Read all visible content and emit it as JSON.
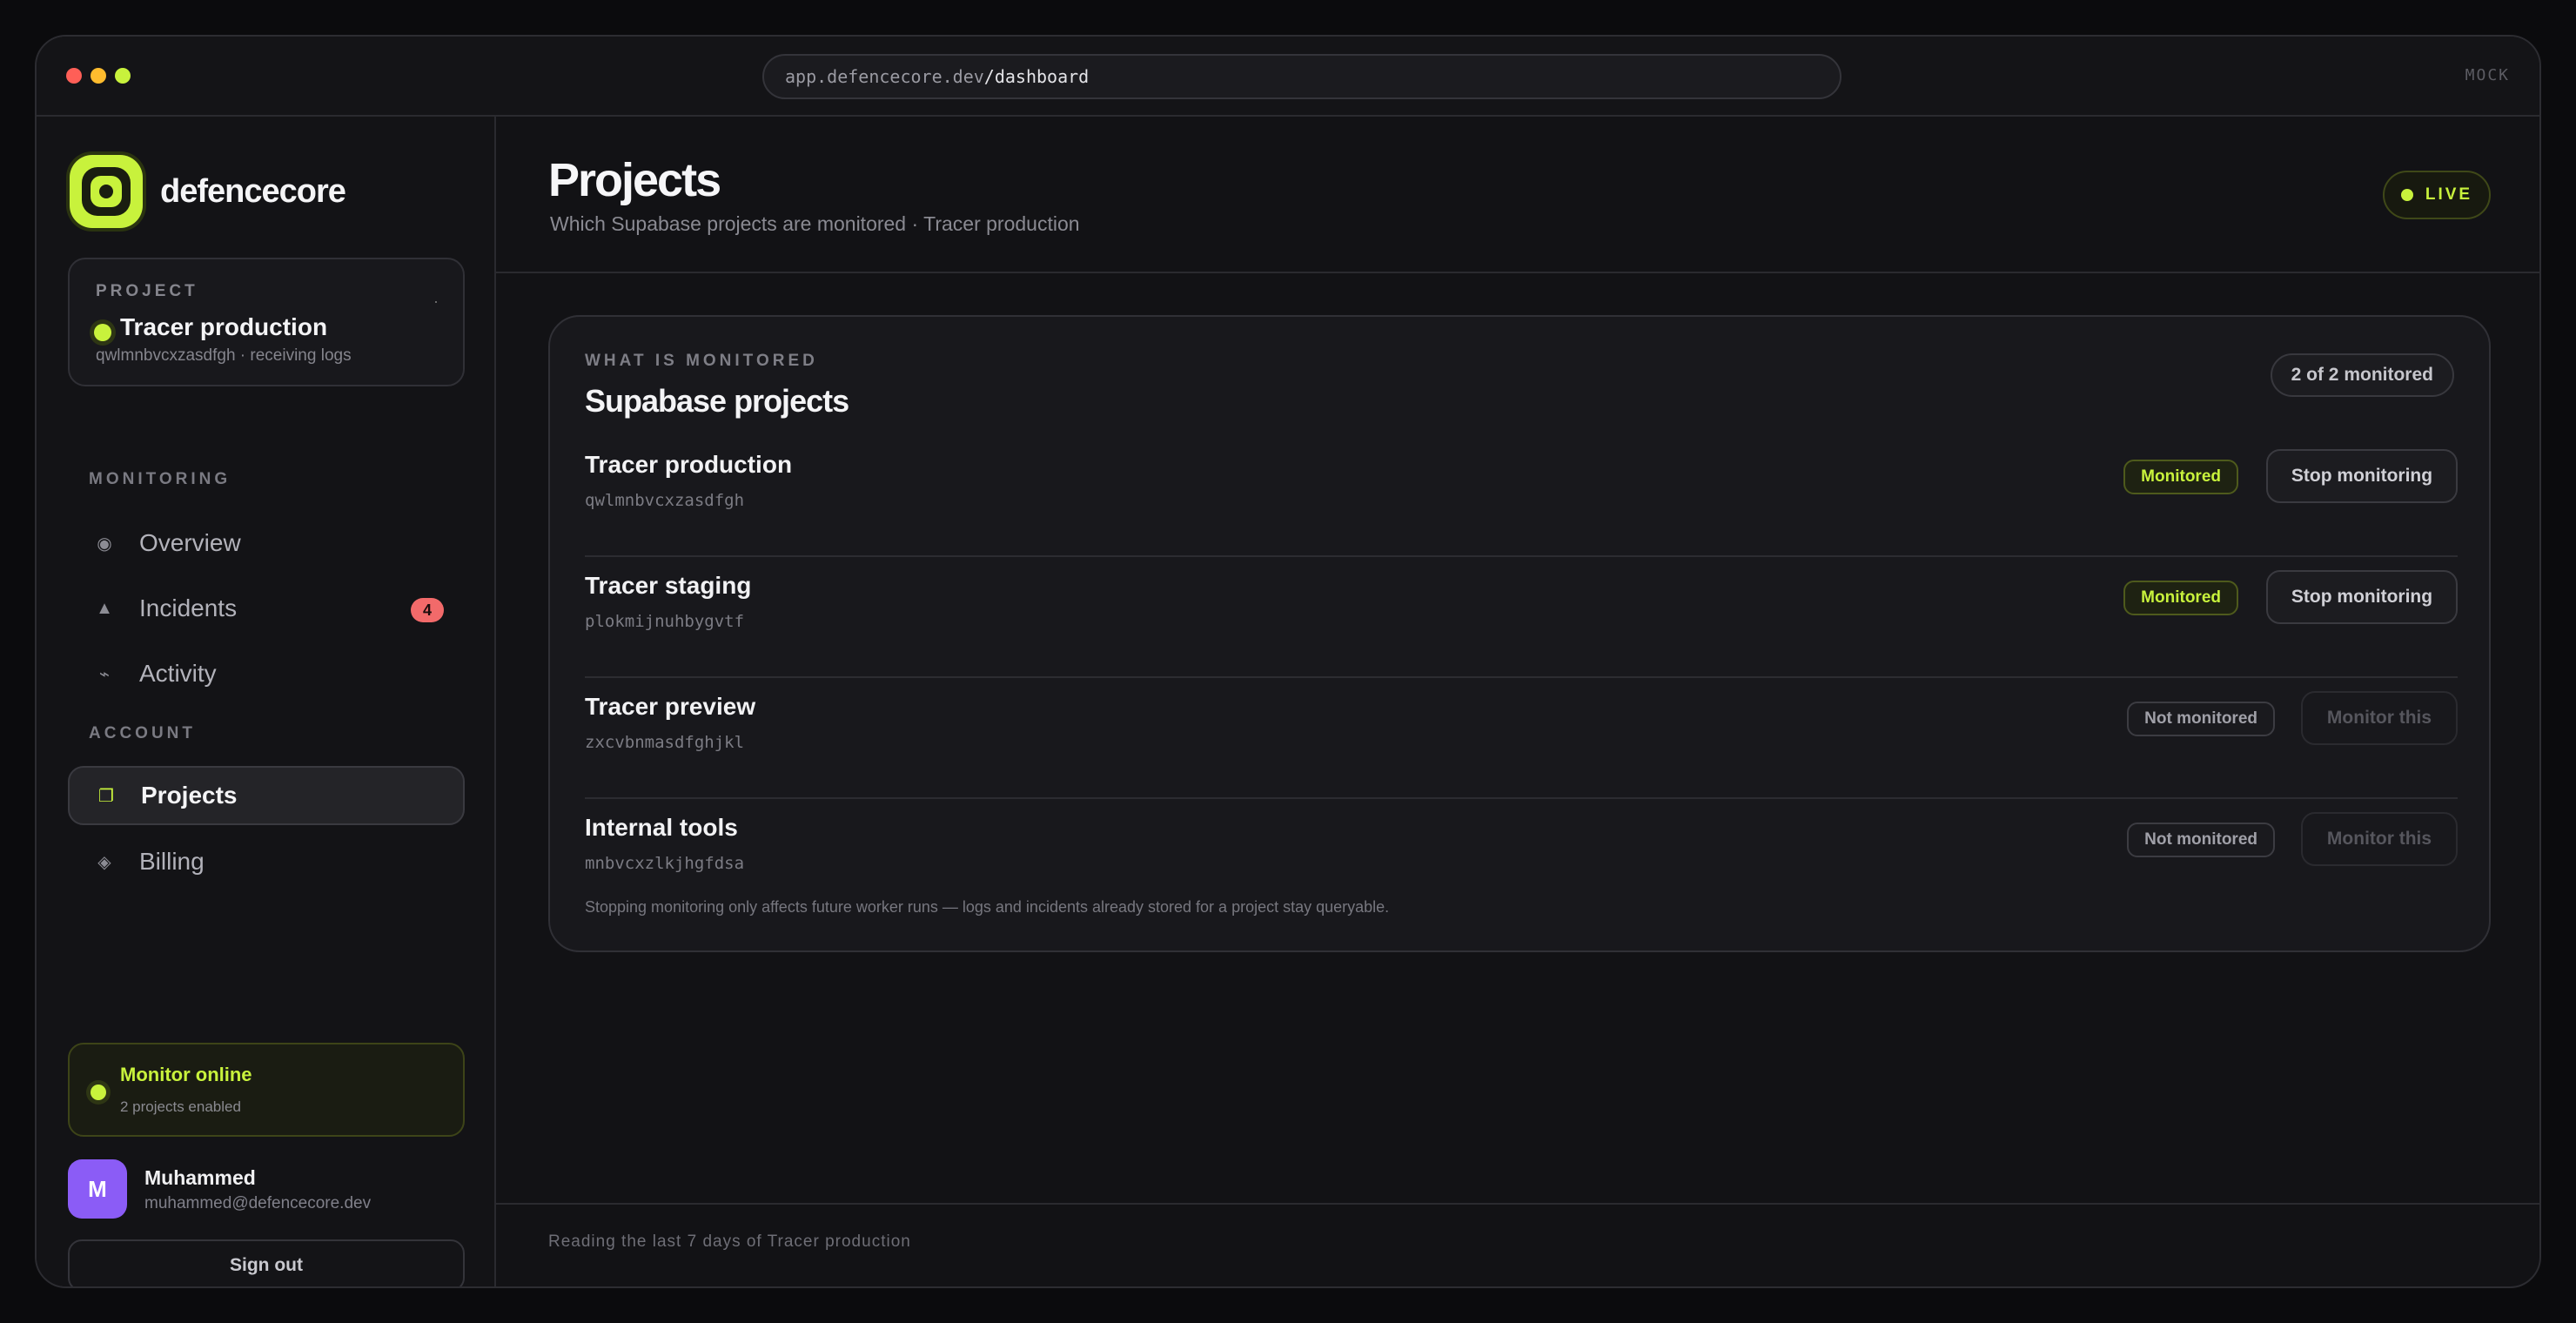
{
  "browser": {
    "url_host": "app.defencecore.dev",
    "url_path": "/dashboard",
    "mock_label": "MOCK"
  },
  "brand": {
    "name": "defencecore",
    "accent_color": "#c8f23c"
  },
  "project_selector": {
    "label": "PROJECT",
    "name": "Tracer production",
    "subtitle": "qwlmnbvcxzasdfgh · receiving logs",
    "chevron": "·"
  },
  "sidebar": {
    "monitoring_label": "MONITORING",
    "monitoring_items": [
      {
        "label": "Overview",
        "icon": "◉",
        "icon_name": "overview-icon"
      },
      {
        "label": "Incidents",
        "icon": "▲",
        "icon_name": "warning-triangle-icon",
        "badge": "4"
      },
      {
        "label": "Activity",
        "icon": "⌁",
        "icon_name": "activity-icon"
      }
    ],
    "account_label": "ACCOUNT",
    "account_items": [
      {
        "label": "Projects",
        "icon": "❐",
        "icon_name": "projects-icon",
        "active": true
      },
      {
        "label": "Billing",
        "icon": "◈",
        "icon_name": "billing-icon"
      }
    ]
  },
  "monitor_status": {
    "title": "Monitor online",
    "subtitle": "2 projects enabled"
  },
  "user": {
    "initial": "M",
    "name": "Muhammed",
    "email": "muhammed@defencecore.dev",
    "avatar_color": "#8b5cf6"
  },
  "sign_out_label": "Sign out",
  "page": {
    "title": "Projects",
    "subtitle": "Which Supabase projects are monitored · Tracer production",
    "live_label": "LIVE"
  },
  "panel": {
    "label": "WHAT IS MONITORED",
    "title": "Supabase projects",
    "count": "2 of 2 monitored",
    "note": "Stopping monitoring only affects future worker runs — logs and incidents already stored for a project stay queryable.",
    "projects": [
      {
        "name": "Tracer production",
        "id": "qwlmnbvcxzasdfgh",
        "status": "Monitored",
        "action": "Stop monitoring",
        "monitored": true
      },
      {
        "name": "Tracer staging",
        "id": "plokmijnuhbygvtf",
        "status": "Monitored",
        "action": "Stop monitoring",
        "monitored": true
      },
      {
        "name": "Tracer preview",
        "id": "zxcvbnmasdfghjkl",
        "status": "Not monitored",
        "action": "Monitor this",
        "monitored": false
      },
      {
        "name": "Internal tools",
        "id": "mnbvcxzlkjhgfdsa",
        "status": "Not monitored",
        "action": "Monitor this",
        "monitored": false
      }
    ]
  },
  "footer": {
    "text": "Reading the last 7 days of Tracer production"
  }
}
